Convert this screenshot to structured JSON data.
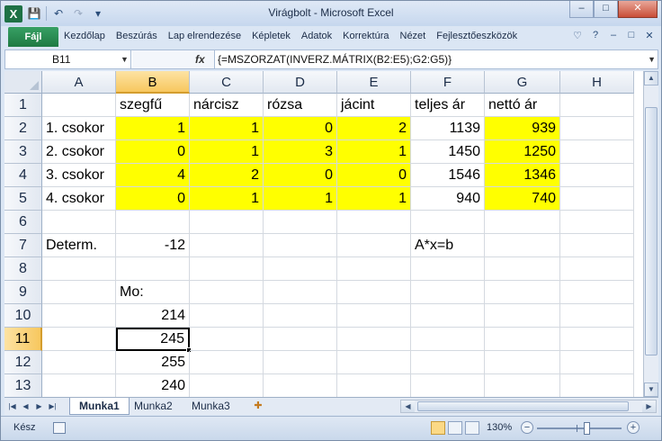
{
  "window": {
    "title": "Virágbolt - Microsoft Excel",
    "qat_icons": [
      "excel-logo-icon",
      "save-icon",
      "undo-icon",
      "redo-icon",
      "customize-arrow-icon"
    ],
    "buttons": {
      "minimize": "–",
      "maximize": "□",
      "close": "✕"
    }
  },
  "ribbon": {
    "file_tab": "Fájl",
    "tabs": [
      "Kezdőlap",
      "Beszúrás",
      "Lap elrendezése",
      "Képletek",
      "Adatok",
      "Korrektúra",
      "Nézet",
      "Fejlesztőeszközök"
    ],
    "right_icons": {
      "collapse": "♡",
      "help": "?",
      "min": "–",
      "restore": "□",
      "close": "✕"
    }
  },
  "formula_bar": {
    "name_box": "B11",
    "fx_label": "fx",
    "formula": "{=MSZORZAT(INVERZ.MÁTRIX(B2:E5);G2:G5)}"
  },
  "columns": [
    "A",
    "B",
    "C",
    "D",
    "E",
    "F",
    "G",
    "H"
  ],
  "rows": [
    "1",
    "2",
    "3",
    "4",
    "5",
    "6",
    "7",
    "8",
    "9",
    "10",
    "11",
    "12",
    "13"
  ],
  "selected": {
    "column": "B",
    "row": "11"
  },
  "cells": {
    "B1": "szegfű",
    "C1": "nárcisz",
    "D1": "rózsa",
    "E1": "jácint",
    "F1": "teljes ár",
    "G1": "nettó ár",
    "A2": "1. csokor",
    "B2": "1",
    "C2": "1",
    "D2": "0",
    "E2": "2",
    "F2": "1139",
    "G2": "939",
    "A3": "2. csokor",
    "B3": "0",
    "C3": "1",
    "D3": "3",
    "E3": "1",
    "F3": "1450",
    "G3": "1250",
    "A4": "3. csokor",
    "B4": "4",
    "C4": "2",
    "D4": "0",
    "E4": "0",
    "F4": "1546",
    "G4": "1346",
    "A5": "4. csokor",
    "B5": "0",
    "C5": "1",
    "D5": "1",
    "E5": "1",
    "F5": "940",
    "G5": "740",
    "A7": "Determ.",
    "B7": "-12",
    "F7": "A*x=b",
    "B9": "Mo:",
    "B10": "214",
    "B11": "245",
    "B12": "255",
    "B13": "240"
  },
  "highlight_color": "#ffff00",
  "sheets": {
    "tabs": [
      "Munka1",
      "Munka2",
      "Munka3"
    ],
    "active": "Munka1"
  },
  "status": {
    "ready": "Kész",
    "zoom": "130%",
    "zoom_minus": "−",
    "zoom_plus": "+"
  }
}
